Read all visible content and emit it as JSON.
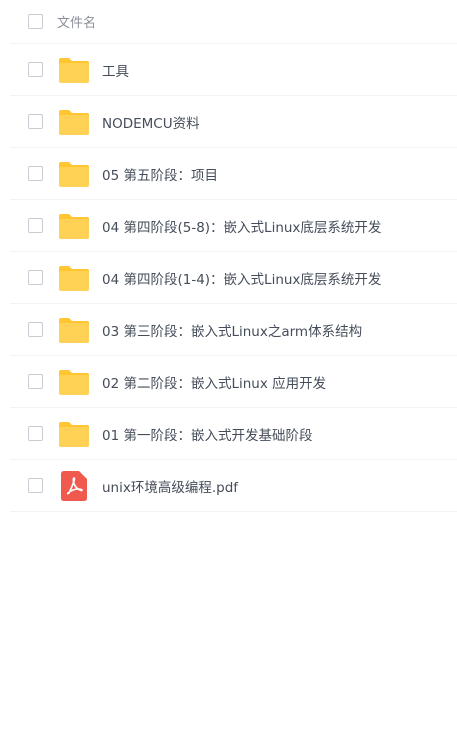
{
  "header": {
    "name_column_label": "文件名"
  },
  "colors": {
    "folder": "#ffd154",
    "folder_dark": "#ffc631",
    "pdf": "#f05a4e",
    "text": "#454d5a",
    "header_text": "#8a8f99"
  },
  "files": [
    {
      "name": "工具",
      "type": "folder",
      "icon": "folder-icon"
    },
    {
      "name": "NODEMCU资料",
      "type": "folder",
      "icon": "folder-icon"
    },
    {
      "name": "05 第五阶段：项目",
      "type": "folder",
      "icon": "folder-icon"
    },
    {
      "name": "04 第四阶段(5-8)：嵌入式Linux底层系统开发",
      "type": "folder",
      "icon": "folder-icon"
    },
    {
      "name": "04 第四阶段(1-4)：嵌入式Linux底层系统开发",
      "type": "folder",
      "icon": "folder-icon"
    },
    {
      "name": "03 第三阶段：嵌入式Linux之arm体系结构",
      "type": "folder",
      "icon": "folder-icon"
    },
    {
      "name": "02 第二阶段：嵌入式Linux 应用开发",
      "type": "folder",
      "icon": "folder-icon"
    },
    {
      "name": "01 第一阶段：嵌入式开发基础阶段",
      "type": "folder",
      "icon": "folder-icon"
    },
    {
      "name": "unix环境高级编程.pdf",
      "type": "pdf",
      "icon": "pdf-icon"
    }
  ]
}
